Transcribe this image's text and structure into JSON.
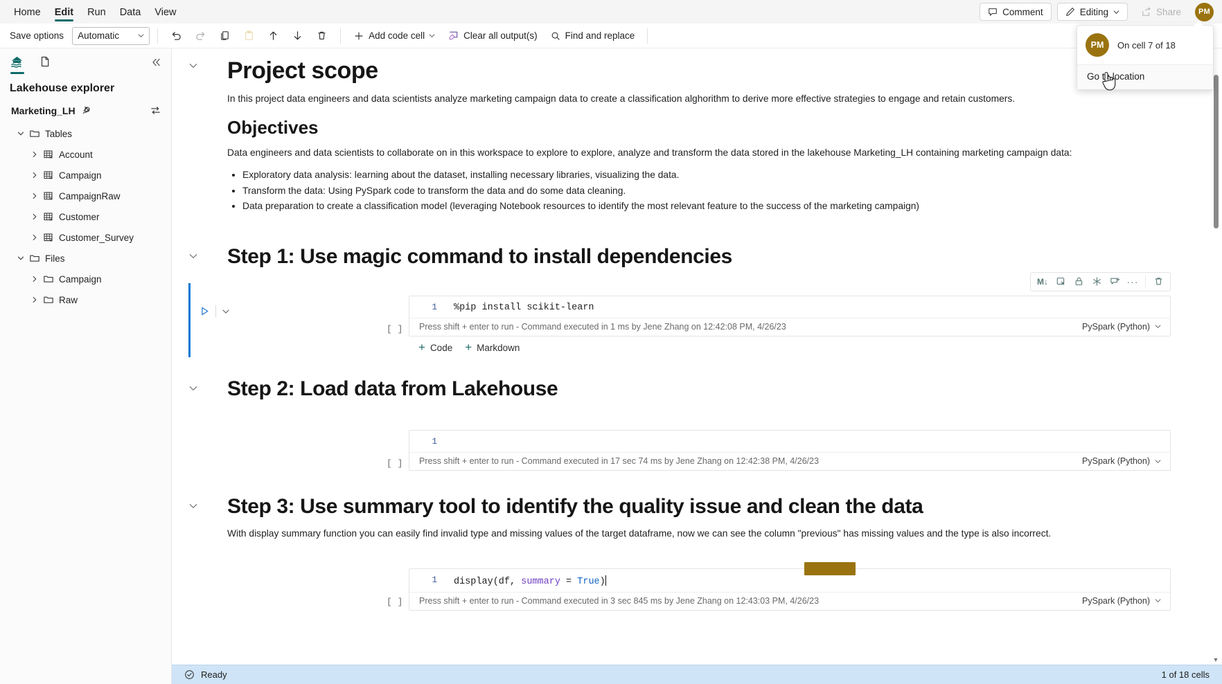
{
  "ribbon": {
    "tabs": [
      {
        "label": "Home",
        "active": false
      },
      {
        "label": "Edit",
        "active": true
      },
      {
        "label": "Run",
        "active": false
      },
      {
        "label": "Data",
        "active": false
      },
      {
        "label": "View",
        "active": false
      }
    ],
    "comment_label": "Comment",
    "editing_label": "Editing",
    "share_label": "Share",
    "avatar_initials": "PM"
  },
  "toolbar": {
    "save_options_label": "Save options",
    "save_mode_value": "Automatic",
    "undo_icon": "undo-icon",
    "redo_icon": "redo-icon",
    "copy_icon": "copy-icon",
    "paste_icon": "paste-icon",
    "move_up_icon": "arrow-up-icon",
    "move_down_icon": "arrow-down-icon",
    "delete_icon": "trash-icon",
    "add_code_cell_label": "Add code cell",
    "clear_outputs_label": "Clear all output(s)",
    "find_replace_label": "Find and replace"
  },
  "presence_popup": {
    "avatar_initials": "PM",
    "status_text": "On cell 7 of 18",
    "action_label": "Go to location"
  },
  "sidebar": {
    "lakehouse_tab_icon": "lakehouse-icon",
    "snapshot_tab_icon": "document-icon",
    "collapse_icon": "chevron-double-left-icon",
    "title": "Lakehouse explorer",
    "lakehouse_name": "Marketing_LH",
    "pin_icon": "pin-icon",
    "swap_icon": "swap-icon",
    "tree": [
      {
        "label": "Tables",
        "type": "folder",
        "expanded": true,
        "level": 0
      },
      {
        "label": "Account",
        "type": "table",
        "expanded": false,
        "level": 1
      },
      {
        "label": "Campaign",
        "type": "table",
        "expanded": false,
        "level": 1
      },
      {
        "label": "CampaignRaw",
        "type": "table",
        "expanded": false,
        "level": 1
      },
      {
        "label": "Customer",
        "type": "table",
        "expanded": false,
        "level": 1
      },
      {
        "label": "Customer_Survey",
        "type": "table",
        "expanded": false,
        "level": 1
      },
      {
        "label": "Files",
        "type": "folder",
        "expanded": true,
        "level": 0
      },
      {
        "label": "Campaign",
        "type": "folder",
        "expanded": false,
        "level": 1
      },
      {
        "label": "Raw",
        "type": "folder",
        "expanded": false,
        "level": 1
      }
    ]
  },
  "notebook": {
    "project_scope": {
      "heading": "Project scope",
      "paragraph": "In this project data engineers and data scientists analyze marketing campaign data to create a classification alghorithm to derive more effective strategies to engage and retain customers.",
      "objectives_heading": "Objectives",
      "objectives_paragraph": "Data engineers and data scientists to collaborate on in this workspace to explore to explore, analyze and transform the data stored in the lakehouse Marketing_LH containing marketing campaign data:",
      "bullets": [
        "Exploratory data analysis: learning about the dataset, installing necessary libraries, visualizing the data.",
        "Transform the data: Using PySpark code to transform the data and do some data cleaning.",
        "Data preparation to create a classification model (leveraging Notebook resources to identify the most relevant feature to the success of the marketing campaign)"
      ]
    },
    "step1": {
      "heading": "Step 1: Use magic command to install dependencies",
      "cell": {
        "exec_count": "[ ]",
        "line_number": "1",
        "code": "%pip install scikit-learn",
        "status": "Press shift + enter to run - Command executed in 1 ms by Jene Zhang on 12:42:08 PM, 4/26/23",
        "language": "PySpark (Python)"
      },
      "add_code_label": "Code",
      "add_markdown_label": "Markdown",
      "cell_actions": [
        {
          "name": "convert-to-markdown-icon",
          "glyph": "M↓"
        },
        {
          "name": "clear-output-icon",
          "glyph": "clear"
        },
        {
          "name": "lock-icon",
          "glyph": "lock"
        },
        {
          "name": "freeze-icon",
          "glyph": "✳"
        },
        {
          "name": "add-comment-icon",
          "glyph": "comment"
        },
        {
          "name": "more-options-icon",
          "glyph": "···"
        },
        {
          "name": "delete-cell-icon",
          "glyph": "trash"
        }
      ]
    },
    "step2": {
      "heading": "Step 2: Load data from Lakehouse",
      "cell": {
        "exec_count": "[ ]",
        "line_number": "1",
        "code": "",
        "status": "Press shift + enter to run - Command executed in 17 sec 74 ms by Jene Zhang on 12:42:38 PM, 4/26/23",
        "language": "PySpark (Python)"
      }
    },
    "step3": {
      "heading": "Step 3: Use summary tool to identify the quality issue and clean the data",
      "paragraph": "With display summary function you can easily find invalid type and missing values of the target dataframe, now we can see the column \"previous\" has missing values and the type is also incorrect.",
      "cell": {
        "exec_count": "[ ]",
        "line_number": "1",
        "code_parts": [
          {
            "text": "display(df, ",
            "type": "plain"
          },
          {
            "text": "summary",
            "type": "var"
          },
          {
            "text": " = ",
            "type": "plain"
          },
          {
            "text": "True",
            "type": "kw"
          },
          {
            "text": ")",
            "type": "plain"
          }
        ],
        "status": "Press shift + enter to run - Command executed in 3 sec 845 ms by Jene Zhang on 12:43:03 PM, 4/26/23",
        "language": "PySpark (Python)"
      }
    }
  },
  "statusbar": {
    "status_icon": "check-circle-icon",
    "status_text": "Ready",
    "cell_count_text": "1 of 18 cells"
  },
  "colors": {
    "accent_teal": "#0f6b68",
    "accent_blue": "#0078d4",
    "collab_gold": "#9a7310",
    "statusbar_bg": "#cfe4f7"
  }
}
